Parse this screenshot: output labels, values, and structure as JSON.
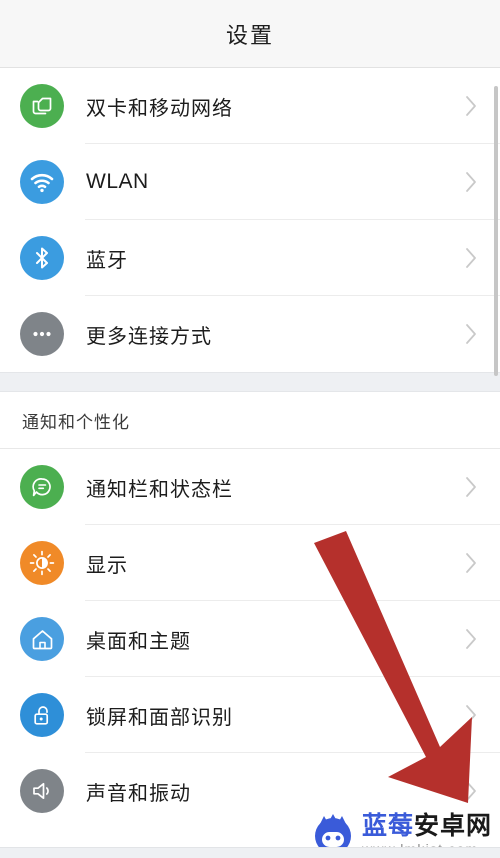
{
  "header": {
    "title": "设置"
  },
  "groups": [
    {
      "name": "connectivity",
      "header": null,
      "items": [
        {
          "label": "双卡和移动网络",
          "icon": "sim-card-icon",
          "icon_bg": "#4caf50",
          "latin": false
        },
        {
          "label": "WLAN",
          "icon": "wifi-icon",
          "icon_bg": "#3b9ce0",
          "latin": true
        },
        {
          "label": "蓝牙",
          "icon": "bluetooth-icon",
          "icon_bg": "#3b9ce0",
          "latin": false
        },
        {
          "label": "更多连接方式",
          "icon": "more-dots-icon",
          "icon_bg": "#7f8489",
          "latin": false
        }
      ]
    },
    {
      "name": "notification-personalization",
      "header": "通知和个性化",
      "items": [
        {
          "label": "通知栏和状态栏",
          "icon": "speech-bubble-icon",
          "icon_bg": "#4caf50",
          "latin": false
        },
        {
          "label": "显示",
          "icon": "brightness-sun-icon",
          "icon_bg": "#f08a28",
          "latin": false
        },
        {
          "label": "桌面和主题",
          "icon": "home-house-icon",
          "icon_bg": "#4a9fe0",
          "latin": false
        },
        {
          "label": "锁屏和面部识别",
          "icon": "unlocked-padlock-icon",
          "icon_bg": "#2e8fd8",
          "latin": false
        },
        {
          "label": "声音和振动",
          "icon": "speaker-volume-icon",
          "icon_bg": "#7f8489",
          "latin": false
        }
      ]
    }
  ],
  "annotation": {
    "arrow_color": "#b5302c",
    "direction": "down-right"
  },
  "watermark": {
    "title_blue": "蓝莓",
    "title_dark": "安卓网",
    "url": "www.lmkjst.com",
    "logo_color": "#3a5bd9"
  },
  "colors": {
    "page_bg": "#ffffff",
    "header_bg": "#f7f7f7",
    "divider": "#ececec",
    "group_gap": "#eef0f3",
    "chevron": "#c9c9c9",
    "scrollbar": "#c6c6c6"
  }
}
